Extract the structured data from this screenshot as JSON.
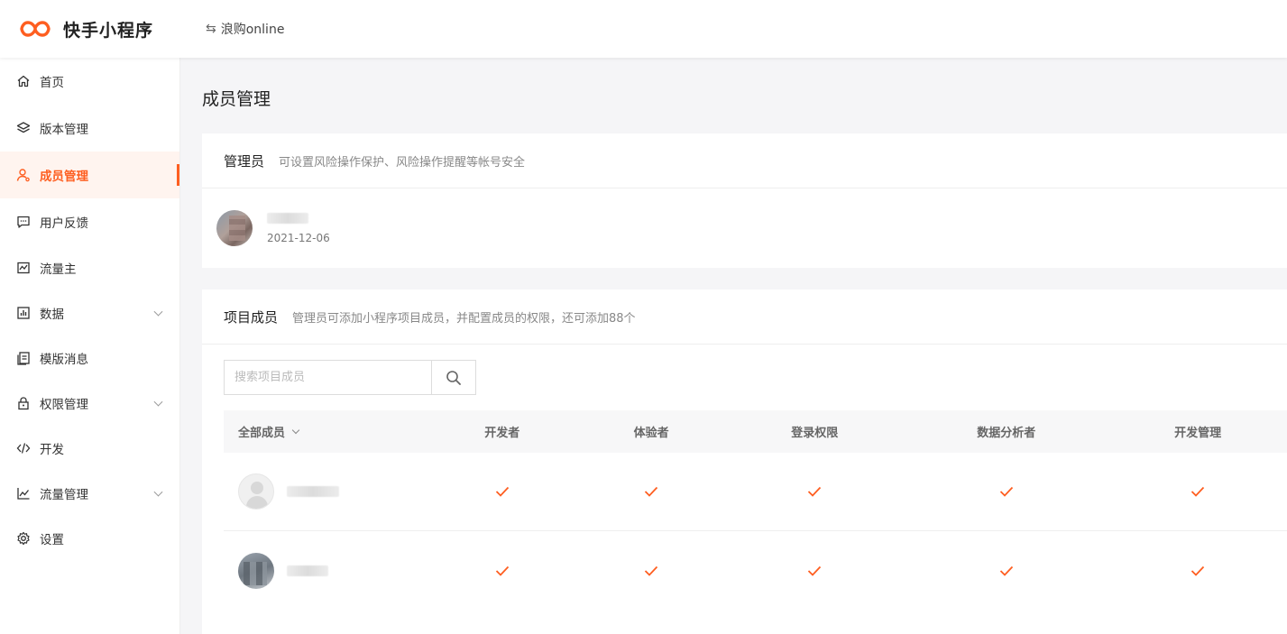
{
  "header": {
    "brand": "快手小程序",
    "brand_color": "#fe5e20",
    "switch_icon": "⇆",
    "app_name": "浪购online"
  },
  "sidebar": {
    "items": [
      {
        "label": "首页",
        "icon": "home-icon"
      },
      {
        "label": "版本管理",
        "icon": "layers-icon"
      },
      {
        "label": "成员管理",
        "icon": "user-icon",
        "active": true
      },
      {
        "label": "用户反馈",
        "icon": "chat-icon"
      },
      {
        "label": "流量主",
        "icon": "traffic-icon"
      },
      {
        "label": "数据",
        "icon": "chart-icon",
        "expandable": true
      },
      {
        "label": "模版消息",
        "icon": "template-icon"
      },
      {
        "label": "权限管理",
        "icon": "lock-icon",
        "expandable": true
      },
      {
        "label": "开发",
        "icon": "code-icon"
      },
      {
        "label": "流量管理",
        "icon": "trend-icon",
        "expandable": true
      },
      {
        "label": "设置",
        "icon": "gear-icon"
      }
    ]
  },
  "main": {
    "page_title": "成员管理",
    "admin": {
      "title": "管理员",
      "desc": "可设置风险操作保护、风险操作提醒等帐号安全",
      "date": "2021-12-06"
    },
    "members": {
      "title": "项目成员",
      "desc": "管理员可添加小程序项目成员，并配置成员的权限，还可添加88个",
      "search_placeholder": "搜索项目成员",
      "filter_label": "全部成员",
      "columns": [
        "开发者",
        "体验者",
        "登录权限",
        "数据分析者",
        "开发管理"
      ],
      "check_color": "#fe5e20"
    }
  }
}
